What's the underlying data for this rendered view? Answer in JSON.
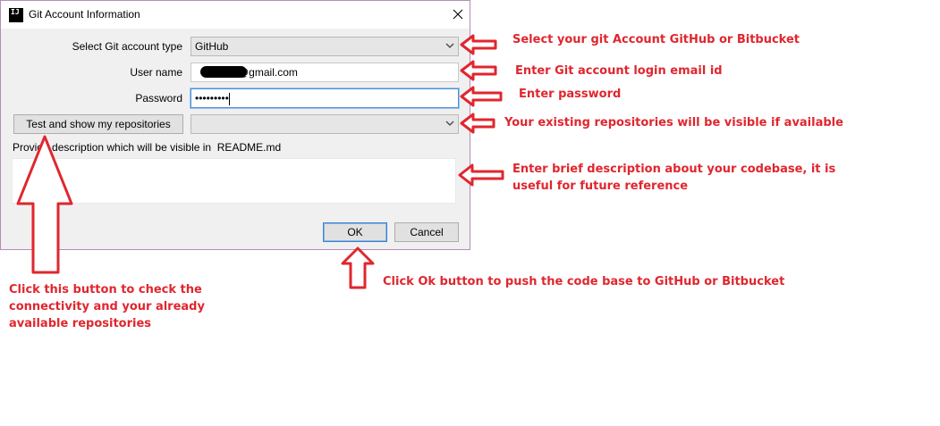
{
  "window": {
    "title": "Git Account Information",
    "icon_text": "IJ"
  },
  "form": {
    "account_type_label": "Select Git account type",
    "account_type_value": "GitHub",
    "username_label": "User name",
    "username_value": "@gmail.com",
    "password_label": "Password",
    "password_value": "•••••••••",
    "test_button_label": "Test and show my repositories",
    "repositories_value": "",
    "description_label": "Provide description which will be visible in  README.md",
    "description_value": ""
  },
  "buttons": {
    "ok": "OK",
    "cancel": "Cancel"
  },
  "annotations": {
    "account_type": "Select your git Account GitHub or Bitbucket",
    "email": "Enter Git account login email id",
    "password": "Enter password",
    "repositories": "Your existing repositories will be visible if available",
    "description_line1": "Enter brief description about your codebase, it is",
    "description_line2": "useful for future reference",
    "test_line1": "Click this button to check the",
    "test_line2": "connectivity and your already",
    "test_line3": "available repositories",
    "ok": "Click Ok button to push the code base to GitHub or Bitbucket"
  },
  "icons": {
    "close": "close-icon",
    "dropdown": "chevron-down-icon",
    "annotation_arrow": "red-arrow-icon"
  },
  "colors": {
    "annotation": "#e0262e",
    "dialog_border": "#b58bb8",
    "focus": "#4a90d6"
  }
}
